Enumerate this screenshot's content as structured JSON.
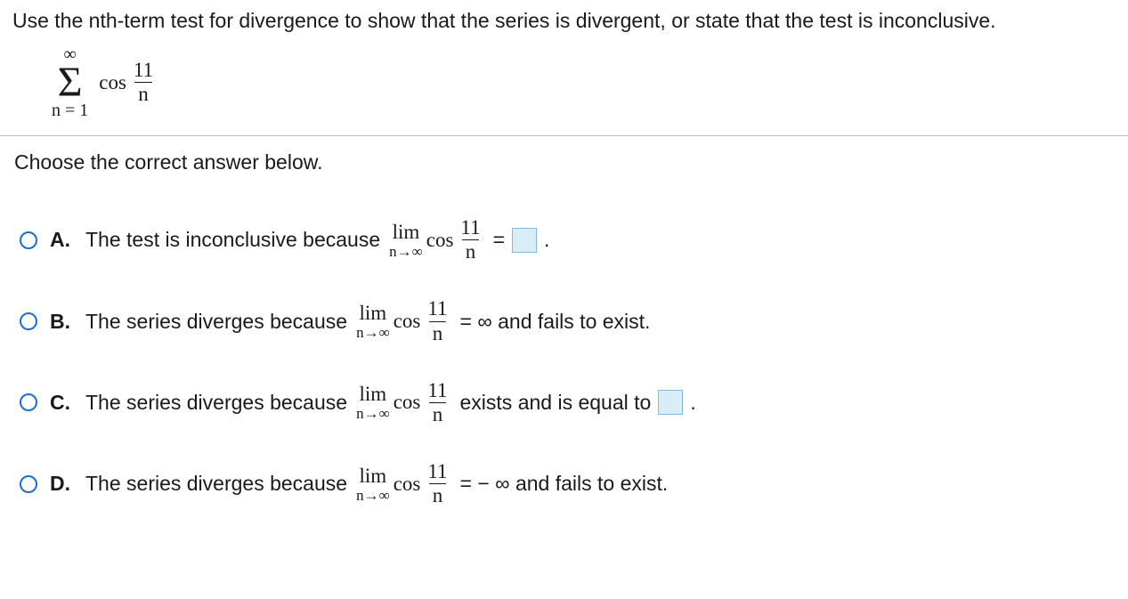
{
  "instruction": "Use the nth-term test for divergence to show that the series is divergent, or state that the test is inconclusive.",
  "series": {
    "upper": "∞",
    "lower": "n = 1",
    "func": "cos",
    "num": "11",
    "den": "n"
  },
  "prompt": "Choose the correct answer below.",
  "common": {
    "lim": "lim",
    "lim_sub": "n→∞",
    "cos": "cos",
    "frac_num": "11",
    "frac_den": "n"
  },
  "options": {
    "A": {
      "letter": "A.",
      "pre": "The test is inconclusive because",
      "post_eq": "=",
      "post_period": "."
    },
    "B": {
      "letter": "B.",
      "pre": "The series diverges because",
      "post": "= ∞ and fails to exist."
    },
    "C": {
      "letter": "C.",
      "pre": "The series diverges because",
      "mid": "exists and is equal to",
      "post_period": "."
    },
    "D": {
      "letter": "D.",
      "pre": "The series diverges because",
      "post": "= − ∞ and fails to exist."
    }
  }
}
